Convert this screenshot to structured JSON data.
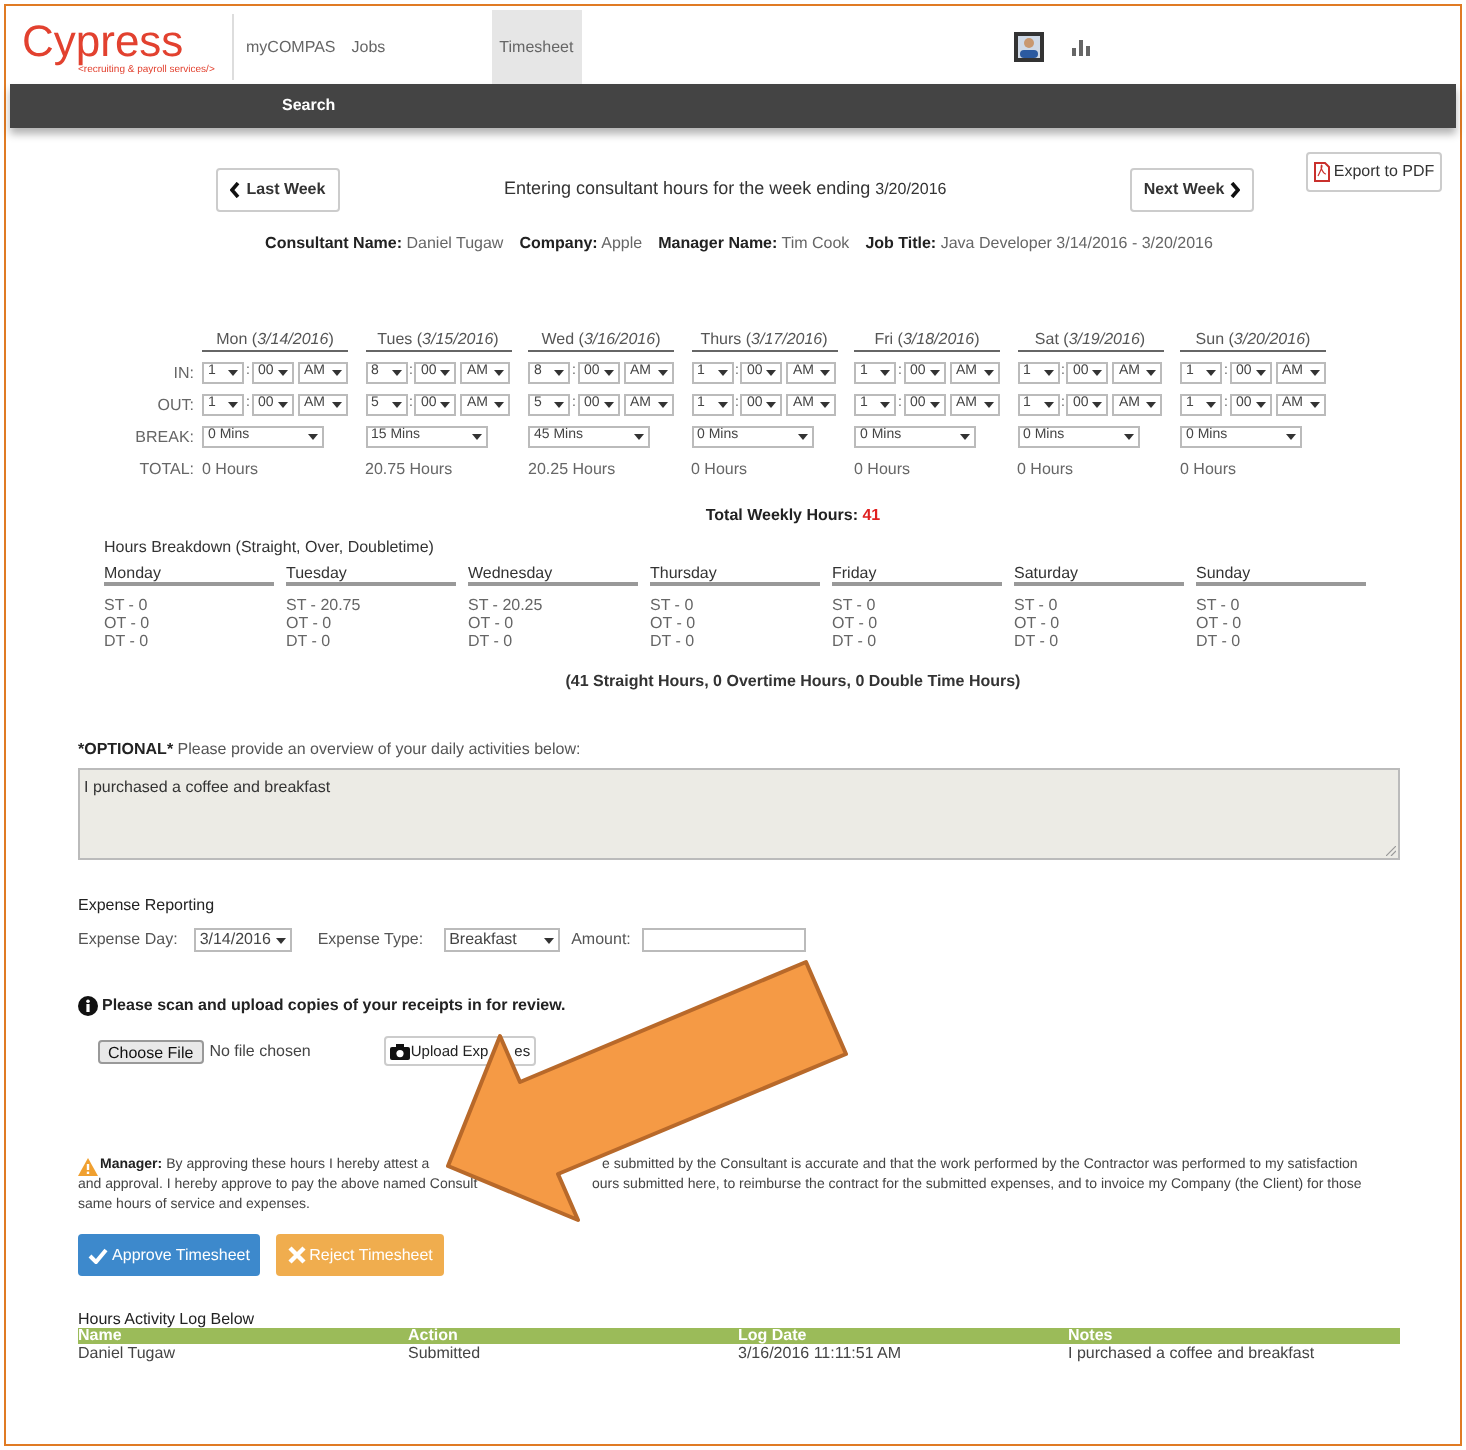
{
  "header": {
    "logo": "Cypress",
    "tagline": "<recruiting & payroll services/>",
    "nav": [
      {
        "label": "myCOMPAS",
        "selected": false
      },
      {
        "label": "Jobs",
        "selected": false
      },
      {
        "label": "Timesheet",
        "selected": true
      }
    ],
    "subnav": [
      "Search"
    ]
  },
  "week": {
    "previous": "Last Week",
    "heading": "Entering consultant hours for the week ending",
    "week_ending": "3/20/2016",
    "next": "Next Week",
    "export": "Export to PDF"
  },
  "info": [
    {
      "label": "Consultant Name:",
      "value": "Daniel Tugaw"
    },
    {
      "label": "Company:",
      "value": "Apple"
    },
    {
      "label": "Manager Name:",
      "value": "Tim Cook"
    },
    {
      "label": "Job Title:",
      "value": "Java Developer 3/14/2016 - 3/20/2016"
    }
  ],
  "row_labels": [
    "IN:",
    "OUT:",
    "BREAK:",
    "TOTAL:"
  ],
  "time_separator": ":",
  "days": [
    {
      "header": "Mon (*3/14/2016*)",
      "in": [
        "1",
        "00",
        "AM"
      ],
      "out": [
        "1",
        "00",
        "AM"
      ],
      "break": "0 Mins",
      "total": "0 Hours"
    },
    {
      "header": "Tues (*3/15/2016*)",
      "in": [
        "8",
        "00",
        "AM"
      ],
      "out": [
        "5",
        "00",
        "AM"
      ],
      "break": "15 Mins",
      "total": "20.75 Hours"
    },
    {
      "header": "Wed (*3/16/2016*)",
      "in": [
        "8",
        "00",
        "AM"
      ],
      "out": [
        "5",
        "00",
        "AM"
      ],
      "break": "45 Mins",
      "total": "20.25 Hours"
    },
    {
      "header": "Thurs (*3/17/2016*)",
      "in": [
        "1",
        "00",
        "AM"
      ],
      "out": [
        "1",
        "00",
        "AM"
      ],
      "break": "0 Mins",
      "total": "0 Hours"
    },
    {
      "header": "Fri (*3/18/2016*)",
      "in": [
        "1",
        "00",
        "AM"
      ],
      "out": [
        "1",
        "00",
        "AM"
      ],
      "break": "0 Mins",
      "total": "0 Hours"
    },
    {
      "header": "Sat (*3/19/2016*)",
      "in": [
        "1",
        "00",
        "AM"
      ],
      "out": [
        "1",
        "00",
        "AM"
      ],
      "break": "0 Mins",
      "total": "0 Hours"
    },
    {
      "header": "Sun (*3/20/2016*)",
      "in": [
        "1",
        "00",
        "AM"
      ],
      "out": [
        "1",
        "00",
        "AM"
      ],
      "break": "0 Mins",
      "total": "0 Hours"
    }
  ],
  "total_weekly": {
    "label": "Total Weekly Hours:",
    "value": "41"
  },
  "breakdown": {
    "title": "Hours Breakdown (Straight, Over, Doubletime)",
    "days": [
      {
        "name": "Monday",
        "lines": [
          "ST - 0",
          "OT - 0",
          "DT - 0"
        ]
      },
      {
        "name": "Tuesday",
        "lines": [
          "ST - 20.75",
          "OT - 0",
          "DT - 0"
        ]
      },
      {
        "name": "Wednesday",
        "lines": [
          "ST - 20.25",
          "OT - 0",
          "DT - 0"
        ]
      },
      {
        "name": "Thursday",
        "lines": [
          "ST - 0",
          "OT - 0",
          "DT - 0"
        ]
      },
      {
        "name": "Friday",
        "lines": [
          "ST - 0",
          "OT - 0",
          "DT - 0"
        ]
      },
      {
        "name": "Saturday",
        "lines": [
          "ST - 0",
          "OT - 0",
          "DT - 0"
        ]
      },
      {
        "name": "Sunday",
        "lines": [
          "ST - 0",
          "OT - 0",
          "DT - 0"
        ]
      }
    ],
    "summary": "(41 Straight Hours, 0 Overtime Hours, 0 Double Time Hours)"
  },
  "activities": {
    "tag": "*OPTIONAL*",
    "prompt": "Please provide an overview of your daily activities below:",
    "value": "I purchased a coffee and breakfast"
  },
  "expense": {
    "title": "Expense Reporting",
    "day_label": "Expense Day:",
    "day": "3/14/2016",
    "type_label": "Expense Type:",
    "type": "Breakfast",
    "amount_label": "Amount:"
  },
  "upload": {
    "note": "Please scan and upload copies of your receipts in for review.",
    "choose": "Choose File",
    "no_file": "No file chosen",
    "upload_parts": [
      "Upload Exp",
      "es"
    ]
  },
  "manager": {
    "label": "Manager:",
    "lines": [
      [
        "By approving these hours I hereby attest a",
        "e submitted by the Consultant is accurate and that the work performed by the Contractor was performed to my satisfaction"
      ],
      [
        "and approval. I hereby approve to pay the above named Consult",
        "ours submitted here, to reimburse the contract for the submitted expenses, and to invoice my Company (the Client) for those"
      ],
      [
        "same hours of service and expenses."
      ]
    ]
  },
  "actions": {
    "approve": "Approve Timesheet",
    "reject": "Reject Timesheet"
  },
  "log": {
    "title": "Hours Activity Log Below",
    "columns": [
      "Name",
      "Action",
      "Log Date",
      "Notes"
    ],
    "rows": [
      [
        "Daniel Tugaw",
        "Submitted",
        "3/16/2016 11:11:51 AM",
        "I purchased a coffee and breakfast"
      ]
    ]
  }
}
